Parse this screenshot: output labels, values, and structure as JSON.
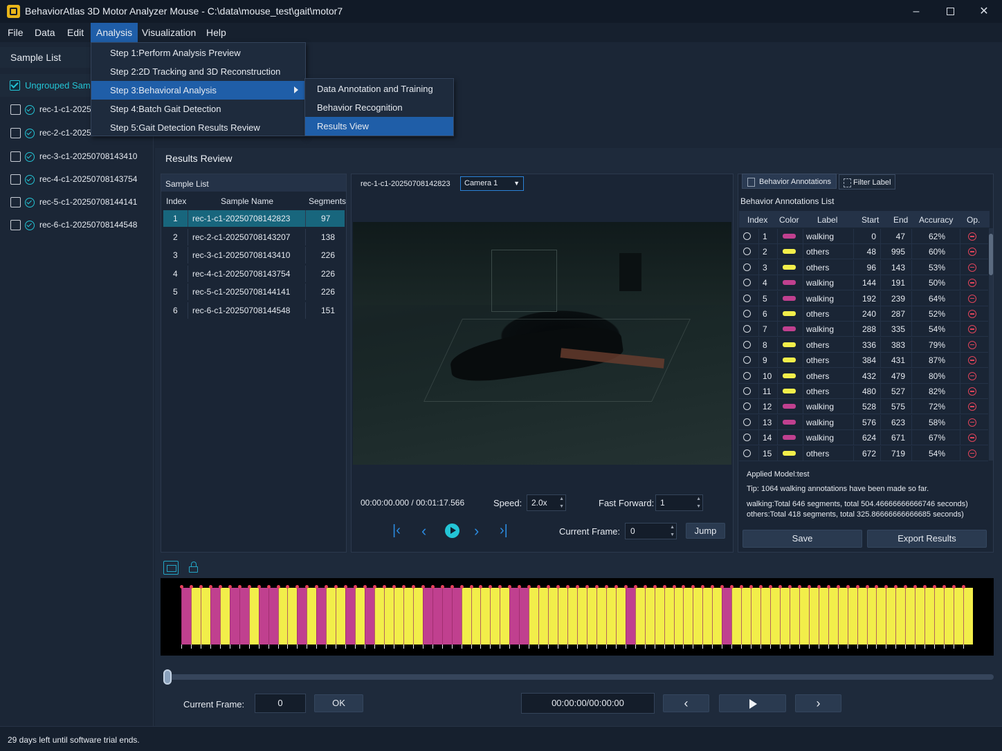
{
  "window": {
    "title": "BehaviorAtlas 3D Motor Analyzer Mouse  -  C:\\data\\mouse_test\\gait\\motor7",
    "minimize_icon": "minimize-icon",
    "maximize_icon": "restore-icon",
    "close_icon": "close-icon"
  },
  "menubar": [
    "File",
    "Data",
    "Edit",
    "Analysis",
    "Visualization",
    "Help"
  ],
  "analysis_menu": {
    "items": [
      "Step 1:Perform Analysis Preview",
      "Step 2:2D Tracking and 3D Reconstruction",
      "Step 3:Behavioral Analysis",
      "Step 4:Batch Gait Detection",
      "Step 5:Gait Detection Results Review"
    ],
    "highlighted_index": 2,
    "submenu": [
      "Data Annotation and Training",
      "Behavior Recognition",
      "Results View"
    ],
    "submenu_highlighted_index": 2
  },
  "sidebar": {
    "title": "Sample List",
    "group": "Ungrouped Samples",
    "group_visible": "Ungrouped Samp",
    "items": [
      {
        "label": "rec-1-c1-20250708142823",
        "visible": "rec-1-c1-20250"
      },
      {
        "label": "rec-2-c1-20250708143207",
        "visible": "rec-2-c1-20250"
      },
      {
        "label": "rec-3-c1-20250708143410",
        "visible": "rec-3-c1-20250708143410"
      },
      {
        "label": "rec-4-c1-20250708143754",
        "visible": "rec-4-c1-20250708143754"
      },
      {
        "label": "rec-5-c1-20250708144141",
        "visible": "rec-5-c1-20250708144141"
      },
      {
        "label": "rec-6-c1-20250708144548",
        "visible": "rec-6-c1-20250708144548"
      }
    ]
  },
  "main": {
    "title": "Results Review",
    "sample_list": {
      "title": "Sample List",
      "columns": [
        "Index",
        "Sample Name",
        "Segments"
      ],
      "rows": [
        {
          "index": "1",
          "name": "rec-1-c1-20250708142823",
          "segments": "97"
        },
        {
          "index": "2",
          "name": "rec-2-c1-20250708143207",
          "segments": "138"
        },
        {
          "index": "3",
          "name": "rec-3-c1-20250708143410",
          "segments": "226"
        },
        {
          "index": "4",
          "name": "rec-4-c1-20250708143754",
          "segments": "226"
        },
        {
          "index": "5",
          "name": "rec-5-c1-20250708144141",
          "segments": "226"
        },
        {
          "index": "6",
          "name": "rec-6-c1-20250708144548",
          "segments": "151"
        }
      ],
      "selected_index": 0
    },
    "video": {
      "sample_name": "rec-1-c1-20250708142823",
      "camera": "Camera 1",
      "time": "00:00:00.000 / 00:01:17.566",
      "speed_label": "Speed:",
      "speed": "2.0x",
      "fast_forward_label": "Fast Forward:",
      "fast_forward": "1",
      "current_frame_label": "Current Frame:",
      "current_frame": "0",
      "jump": "Jump"
    },
    "annotations": {
      "tab_active": "Behavior Annotations",
      "tab_other": "Filter Label",
      "list_title": "Behavior Annotations List",
      "columns": [
        "Index",
        "Color",
        "Label",
        "Start",
        "End",
        "Accuracy",
        "Op."
      ],
      "colors": {
        "walking": "#c0408f",
        "others": "#f2ee4a"
      },
      "rows": [
        {
          "index": "1",
          "label": "walking",
          "start": "0",
          "end": "47",
          "accuracy": "62%"
        },
        {
          "index": "2",
          "label": "others",
          "start": "48",
          "end": "995",
          "accuracy": "60%"
        },
        {
          "index": "3",
          "label": "others",
          "start": "96",
          "end": "143",
          "accuracy": "53%"
        },
        {
          "index": "4",
          "label": "walking",
          "start": "144",
          "end": "191",
          "accuracy": "50%"
        },
        {
          "index": "5",
          "label": "walking",
          "start": "192",
          "end": "239",
          "accuracy": "64%"
        },
        {
          "index": "6",
          "label": "others",
          "start": "240",
          "end": "287",
          "accuracy": "52%"
        },
        {
          "index": "7",
          "label": "walking",
          "start": "288",
          "end": "335",
          "accuracy": "54%"
        },
        {
          "index": "8",
          "label": "others",
          "start": "336",
          "end": "383",
          "accuracy": "79%"
        },
        {
          "index": "9",
          "label": "others",
          "start": "384",
          "end": "431",
          "accuracy": "87%"
        },
        {
          "index": "10",
          "label": "others",
          "start": "432",
          "end": "479",
          "accuracy": "80%"
        },
        {
          "index": "11",
          "label": "others",
          "start": "480",
          "end": "527",
          "accuracy": "82%"
        },
        {
          "index": "12",
          "label": "walking",
          "start": "528",
          "end": "575",
          "accuracy": "72%"
        },
        {
          "index": "13",
          "label": "walking",
          "start": "576",
          "end": "623",
          "accuracy": "58%"
        },
        {
          "index": "14",
          "label": "walking",
          "start": "624",
          "end": "671",
          "accuracy": "67%"
        },
        {
          "index": "15",
          "label": "others",
          "start": "672",
          "end": "719",
          "accuracy": "54%"
        }
      ],
      "applied_model": "Applied Model:test",
      "tip": "Tip: 1064 walking annotations have been made so far.",
      "summary_walking": "walking:Total 646 segments, total 504.46666666666746 seconds)",
      "summary_others": "others:Total 418 segments, total 325.86666666666685 seconds)",
      "save": "Save",
      "export": "Export Results"
    },
    "timeline": {
      "pattern": "WOOWOWWOWWOOWOWOOWOWOOOOOWWWWOOOOOWWOOOOOOOOOOWOOOOOOOOOWOOOOOOOOOOOOOOOOOOOOOOOOO",
      "current_frame_label": "Current Frame:",
      "current_frame": "0",
      "ok": "OK",
      "time": "00:00:00/00:00:00"
    }
  },
  "status": "29 days left until software trial ends."
}
